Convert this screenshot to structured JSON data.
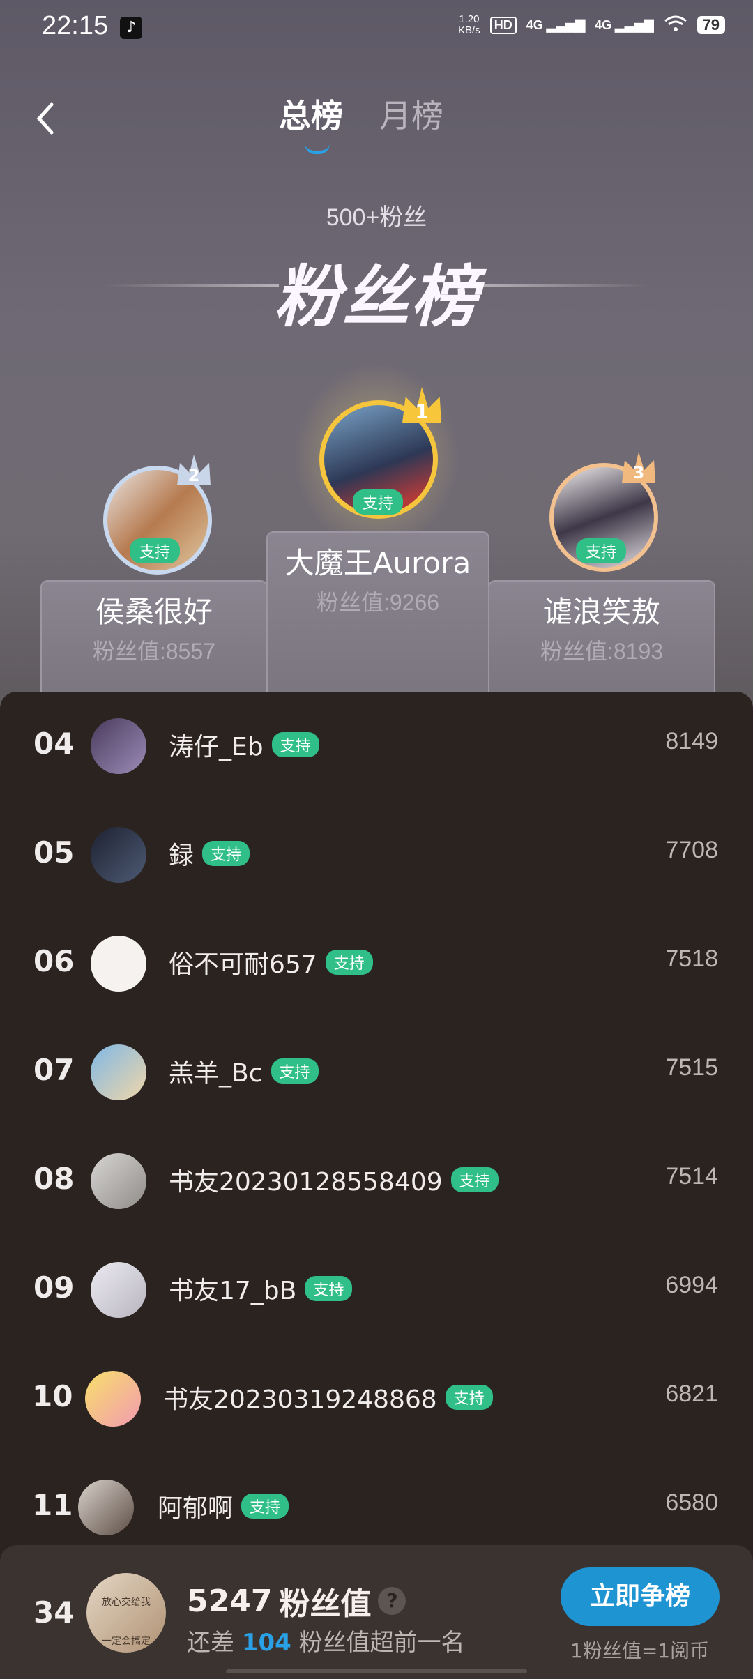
{
  "status_bar": {
    "time": "22:15",
    "speed": "1.20\nKB/s",
    "hd": "HD",
    "signal1": "4G",
    "signal2": "4G",
    "battery": "79"
  },
  "header": {
    "tabs": [
      {
        "label": "总榜",
        "active": true
      },
      {
        "label": "月榜",
        "active": false
      }
    ],
    "subtitle": "500+粉丝",
    "title": "粉丝榜"
  },
  "podium": {
    "support_label": "支持",
    "first": {
      "rank": "1",
      "name": "大魔王Aurora",
      "value": "粉丝值:9266"
    },
    "second": {
      "rank": "2",
      "name": "侯桑很好",
      "value": "粉丝值:8557"
    },
    "third": {
      "rank": "3",
      "name": "谑浪笑敖",
      "value": "粉丝值:8193"
    }
  },
  "list": [
    {
      "rank": "04",
      "name": "涛仔_Eb",
      "tag": "支持",
      "score": "8149"
    },
    {
      "rank": "05",
      "name": "録",
      "tag": "支持",
      "score": "7708"
    },
    {
      "rank": "06",
      "name": "俗不可耐657",
      "tag": "支持",
      "score": "7518"
    },
    {
      "rank": "07",
      "name": "羔羊_Bc",
      "tag": "支持",
      "score": "7515"
    },
    {
      "rank": "08",
      "name": "书友20230128558409",
      "tag": "支持",
      "score": "7514"
    },
    {
      "rank": "09",
      "name": "书友17_bB",
      "tag": "支持",
      "score": "6994"
    },
    {
      "rank": "10",
      "name": "书友20230319248868",
      "tag": "支持",
      "score": "6821"
    },
    {
      "rank": "11",
      "name": "阿郁啊",
      "tag": "支持",
      "score": "6580"
    }
  ],
  "me": {
    "rank": "34",
    "fans_value": "5247",
    "fans_unit": "粉丝值",
    "diff_prefix": "还差",
    "diff_value": "104",
    "diff_suffix": "粉丝值超前一名",
    "button": "立即争榜",
    "note": "1粉丝值=1阅币",
    "avatar_text": "放心交给我\n一定会搞定"
  },
  "colors": {
    "accent": "#1f94d3",
    "tag": "#2fbf87",
    "panel": "#2b2320"
  }
}
